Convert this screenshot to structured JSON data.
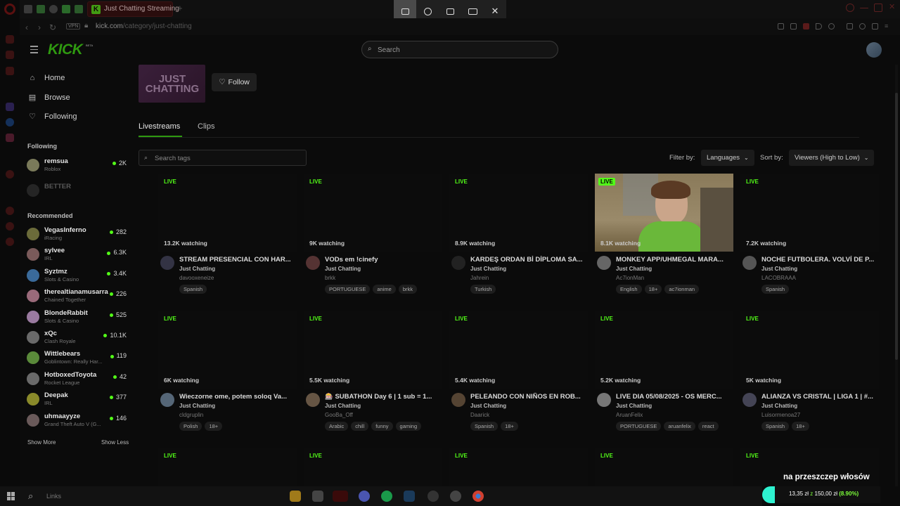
{
  "browser": {
    "tab_title": "Just Chatting Streaming",
    "url_host": "kick.com",
    "url_path": "/category/just-chatting",
    "vpn": "VPN"
  },
  "header": {
    "logo": "KICK",
    "beta": "BETA",
    "search_placeholder": "Search"
  },
  "nav": {
    "items": [
      {
        "label": "Home",
        "icon": "home-icon"
      },
      {
        "label": "Browse",
        "icon": "browse-icon"
      },
      {
        "label": "Following",
        "icon": "heart-icon"
      }
    ],
    "following_header": "Following",
    "following": [
      {
        "name": "remsua",
        "game": "Roblox",
        "viewers": "2K",
        "color": "#7a7a5a"
      },
      {
        "name": "BETTER",
        "game": "",
        "viewers": "",
        "color": "#555"
      }
    ],
    "recommended_header": "Recommended",
    "recommended": [
      {
        "name": "VegasInferno",
        "game": "iRacing",
        "viewers": "282",
        "color": "#6b6b3a"
      },
      {
        "name": "sylvee",
        "game": "IRL",
        "viewers": "6.3K",
        "color": "#7a5a5a"
      },
      {
        "name": "Syztmz",
        "game": "Slots & Casino",
        "viewers": "3.4K",
        "color": "#3a6a9a"
      },
      {
        "name": "therealtianamusarra",
        "game": "Chained Together",
        "viewers": "226",
        "color": "#9a6a7a"
      },
      {
        "name": "BlondeRabbit",
        "game": "Slots & Casino",
        "viewers": "525",
        "color": "#9a7aa0"
      },
      {
        "name": "xQc",
        "game": "Clash Royale",
        "viewers": "10.1K",
        "color": "#6a6a6a"
      },
      {
        "name": "Wittlebears",
        "game": "Goblintown: Really Har...",
        "viewers": "119",
        "color": "#5a8a3a"
      },
      {
        "name": "HotboxedToyota",
        "game": "Rocket League",
        "viewers": "42",
        "color": "#6a6a6a"
      },
      {
        "name": "Deepak",
        "game": "IRL",
        "viewers": "377",
        "color": "#8a8a2a"
      },
      {
        "name": "uhmaayyze",
        "game": "Grand Theft Auto V (G...",
        "viewers": "146",
        "color": "#6a5a5a"
      }
    ],
    "show_more": "Show More",
    "show_less": "Show Less"
  },
  "category": {
    "image_text": "JUST CHATTING",
    "follow_label": "Follow",
    "tab_livestreams": "Livestreams",
    "tab_clips": "Clips",
    "tag_search_placeholder": "Search tags",
    "filter_by": "Filter by:",
    "languages": "Languages",
    "sort_by": "Sort by:",
    "sort_value": "Viewers (High to Low)",
    "live_label": "LIVE"
  },
  "streams": [
    {
      "watching": "13.2K watching",
      "title": "STREAM PRESENCIAL CON HAR...",
      "category": "Just Chatting",
      "user": "davooxeneize",
      "tags": [
        "Spanish"
      ],
      "av": "#334"
    },
    {
      "watching": "9K watching",
      "title": "VODs em !cinefy",
      "category": "Just Chatting",
      "user": "brkk",
      "tags": [
        "PORTUGUESE",
        "anime",
        "brkk"
      ],
      "av": "#533"
    },
    {
      "watching": "8.9K watching",
      "title": "KARDEŞ ORDAN Bİ DİPLOMA SA...",
      "category": "Just Chatting",
      "user": "Jahrein",
      "tags": [
        "Turkish"
      ],
      "av": "#222"
    },
    {
      "watching": "8.1K watching",
      "title": "MONKEY APP/UHMEGAL MARA...",
      "category": "Just Chatting",
      "user": "Ac7ionMan",
      "tags": [
        "English",
        "18+",
        "ac7ionman"
      ],
      "av": "#666"
    },
    {
      "watching": "7.2K watching",
      "title": "NOCHE FUTBOLERA. VOLVÍ DE P...",
      "category": "Just Chatting",
      "user": "LACOBRAAA",
      "tags": [
        "Spanish"
      ],
      "av": "#555"
    },
    {
      "watching": "6K watching",
      "title": "Wieczorne ome, potem soloq Va...",
      "category": "Just Chatting",
      "user": "cldgruplin",
      "tags": [
        "Polish",
        "18+"
      ],
      "av": "#567"
    },
    {
      "watching": "5.5K watching",
      "title": "🎰 SUBATHON Day 6 | 1 sub = 1...",
      "category": "Just Chatting",
      "user": "GooBa_Off",
      "tags": [
        "Arabic",
        "chill",
        "funny",
        "gaming"
      ],
      "av": "#654"
    },
    {
      "watching": "5.4K watching",
      "title": "PELEANDO CON NIÑOS EN ROB...",
      "category": "Just Chatting",
      "user": "Daarick",
      "tags": [
        "Spanish",
        "18+"
      ],
      "av": "#543"
    },
    {
      "watching": "5.2K watching",
      "title": "LIVE DIA 05/08/2025 - OS MERC...",
      "category": "Just Chatting",
      "user": "AruanFelix",
      "tags": [
        "PORTUGUESE",
        "aruanfelix",
        "react"
      ],
      "av": "#777"
    },
    {
      "watching": "5K watching",
      "title": "ALIANZA VS CRISTAL | LIGA 1 | #...",
      "category": "Just Chatting",
      "user": "Luisormenoa27",
      "tags": [
        "Spanish",
        "18+"
      ],
      "av": "#445"
    }
  ],
  "ad": {
    "title": "na przeszczep włosów",
    "price_a": "13,35 zł",
    "price_sep": "z",
    "price_b": "150,00 zł",
    "price_pct": "(8.90%)"
  },
  "taskbar": {
    "search_text": "Links"
  }
}
